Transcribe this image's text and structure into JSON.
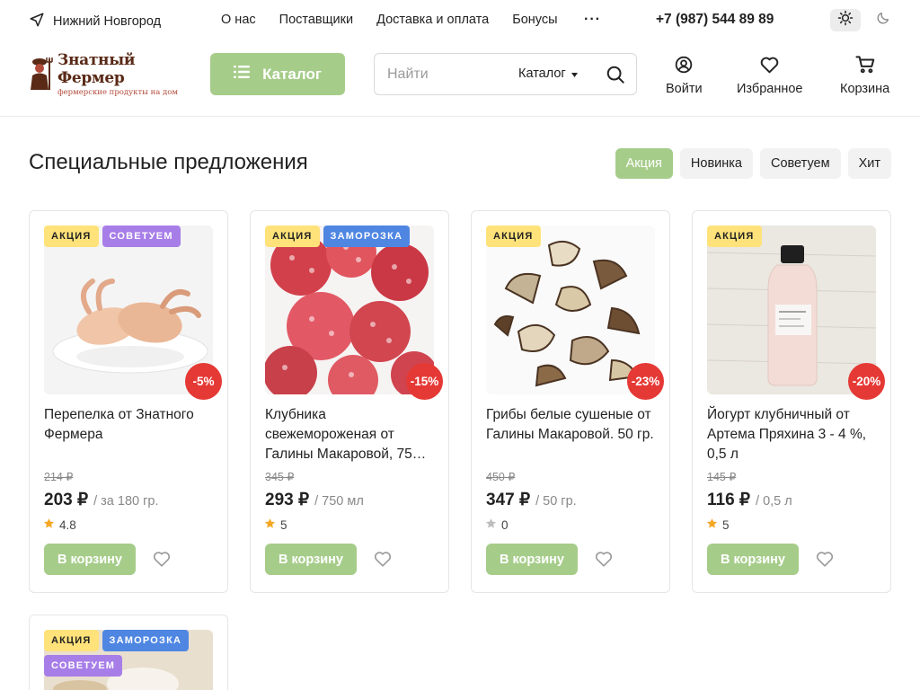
{
  "topbar": {
    "city": "Нижний Новгород",
    "nav": [
      "О нас",
      "Поставщики",
      "Доставка и оплата",
      "Бонусы"
    ],
    "more": "···",
    "phone": "+7 (987) 544 89 89"
  },
  "header": {
    "logo_title": "Знатный Фермер",
    "logo_subtitle": "фермерские продукты на дом",
    "catalog_label": "Каталог",
    "search_placeholder": "Найти",
    "search_scope": "Каталог",
    "login_label": "Войти",
    "favorites_label": "Избранное",
    "cart_label": "Корзина"
  },
  "section": {
    "title": "Специальные предложения",
    "filters": [
      {
        "label": "Акция",
        "active": true
      },
      {
        "label": "Новинка",
        "active": false
      },
      {
        "label": "Советуем",
        "active": false
      },
      {
        "label": "Хит",
        "active": false
      }
    ]
  },
  "badge_labels": {
    "sale": "АКЦИЯ",
    "recommend": "СОВЕТУЕМ",
    "frozen": "ЗАМОРОЗКА"
  },
  "products": [
    {
      "name": "Перепелка от Знатного Фермера",
      "old_price": "214 ₽",
      "price": "203 ₽",
      "unit": "/ за 180 гр.",
      "rating": "4.8",
      "discount": "-5%",
      "cart_label": "В корзину",
      "image": "quail"
    },
    {
      "name": "Клубника свежемороженая от Галины Макаровой, 75…",
      "old_price": "345 ₽",
      "price": "293 ₽",
      "unit": "/ 750 мл",
      "rating": "5",
      "discount": "-15%",
      "cart_label": "В корзину",
      "image": "strawberry"
    },
    {
      "name": "Грибы белые сушеные от Галины Макаровой. 50 гр.",
      "old_price": "450 ₽",
      "price": "347 ₽",
      "unit": "/ 50 гр.",
      "rating": "0",
      "discount": "-23%",
      "cart_label": "В корзину",
      "image": "mushrooms"
    },
    {
      "name": "Йогурт клубничный от Артема Пряхина 3 - 4 %, 0,5 л",
      "old_price": "145 ₽",
      "price": "116 ₽",
      "unit": "/ 0,5 л",
      "rating": "5",
      "discount": "-20%",
      "cart_label": "В корзину",
      "image": "yogurt"
    }
  ],
  "colors": {
    "accent": "#a6cc8a",
    "discount": "#e53935",
    "sale_badge": "#ffe27a",
    "recommend_badge": "#a77ee8",
    "frozen_badge": "#4e86e2",
    "star": "#f5a623"
  }
}
